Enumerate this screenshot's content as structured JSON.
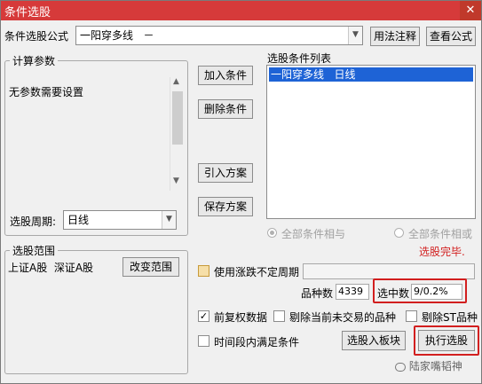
{
  "window": {
    "title": "条件选股",
    "close_icon": "close-icon"
  },
  "formula": {
    "label": "条件选股公式",
    "value": "一阳穿多线   －",
    "usage_btn": "用法注释",
    "view_btn": "查看公式"
  },
  "params": {
    "group_title": "计算参数",
    "text": "无参数需要设置"
  },
  "period": {
    "label": "选股周期:",
    "value": "日线"
  },
  "actions": {
    "add": "加入条件",
    "delete": "删除条件",
    "import": "引入方案",
    "save": "保存方案"
  },
  "conditions": {
    "title": "选股条件列表",
    "items": [
      "一阳穿多线   日线"
    ]
  },
  "logic": {
    "all_and": "全部条件相与",
    "all_or": "全部条件相或"
  },
  "status": {
    "done": "选股完毕."
  },
  "scope": {
    "group_title": "选股范围",
    "text": "上证A股  深证A股",
    "change_btn": "改变范围"
  },
  "options": {
    "variable_period": "使用涨跌不定周期",
    "stock_count_label": "品种数",
    "stock_count": "4339",
    "hit_label": "选中数",
    "hit_value": "9/0.2%",
    "pre_adjust": "前复权数据",
    "exclude_untraded": "剔除当前未交易的品种",
    "exclude_st": "剔除ST品种",
    "time_range": "时间段内满足条件",
    "to_block_btn": "选股入板块",
    "execute_btn": "执行选股"
  },
  "watermark": "陆家嘴韬神",
  "colors": {
    "titlebar": "#d63a3a",
    "highlight": "#d21f1f",
    "selection": "#1e63d6"
  }
}
